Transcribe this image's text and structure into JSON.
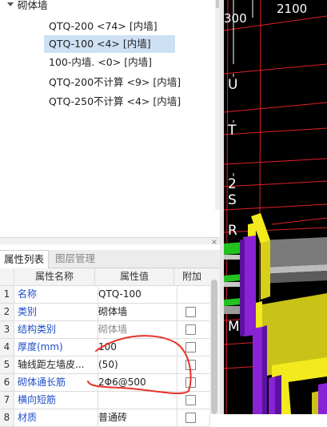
{
  "tree": {
    "parent_label": "砌体墙",
    "items": [
      {
        "label": "QTQ-200 <74> [内墙]",
        "selected": false
      },
      {
        "label": "QTQ-100 <4> [内墙]",
        "selected": true
      },
      {
        "label": "100-内墙. <0> [内墙]",
        "selected": false
      },
      {
        "label": "QTQ-200不计算 <9> [内墙]",
        "selected": false
      },
      {
        "label": "QTQ-250不计算 <4> [内墙]",
        "selected": false
      }
    ]
  },
  "panel": {
    "close_glyph": "×",
    "tabs": [
      "属性列表",
      "图层管理"
    ]
  },
  "grid": {
    "headers": {
      "name": "属性名称",
      "value": "属性值",
      "extra": "附加"
    },
    "rows": [
      {
        "index": "1",
        "name": "名称",
        "value": "QTQ-100",
        "name_color": "blue",
        "value_color": "black",
        "checkbox": false
      },
      {
        "index": "2",
        "name": "类别",
        "value": "砌体墙",
        "name_color": "blue",
        "value_color": "black",
        "checkbox": true
      },
      {
        "index": "3",
        "name": "结构类别",
        "value": "砌体墙",
        "name_color": "blue",
        "value_color": "gray",
        "checkbox": true
      },
      {
        "index": "4",
        "name": "厚度(mm)",
        "value": "100",
        "name_color": "blue",
        "value_color": "black",
        "checkbox": true
      },
      {
        "index": "5",
        "name": "轴线距左墙皮...",
        "value": "(50)",
        "name_color": "black",
        "value_color": "black",
        "checkbox": true
      },
      {
        "index": "6",
        "name": "砌体通长筋",
        "value": "2Φ6@500",
        "name_color": "blue",
        "value_color": "black",
        "checkbox": true
      },
      {
        "index": "7",
        "name": "横向短筋",
        "value": "",
        "name_color": "blue",
        "value_color": "black",
        "checkbox": true
      },
      {
        "index": "8",
        "name": "材质",
        "value": "普通砖",
        "name_color": "blue",
        "value_color": "black",
        "checkbox": true
      }
    ]
  },
  "viewport": {
    "dimension_labels": [
      "300",
      "2100"
    ],
    "axis_labels": [
      "U",
      "T",
      "2",
      "S",
      "R",
      "M"
    ],
    "colors": {
      "background": "#000000",
      "grid_line": "#e0202a",
      "wall_yellow": "#f2ea1c",
      "wall_olive": "#c9c317",
      "purple": "#8a22d6",
      "green": "#22c21f",
      "gray": "#a8a8a8",
      "annotation_red": "#e8322a"
    }
  }
}
